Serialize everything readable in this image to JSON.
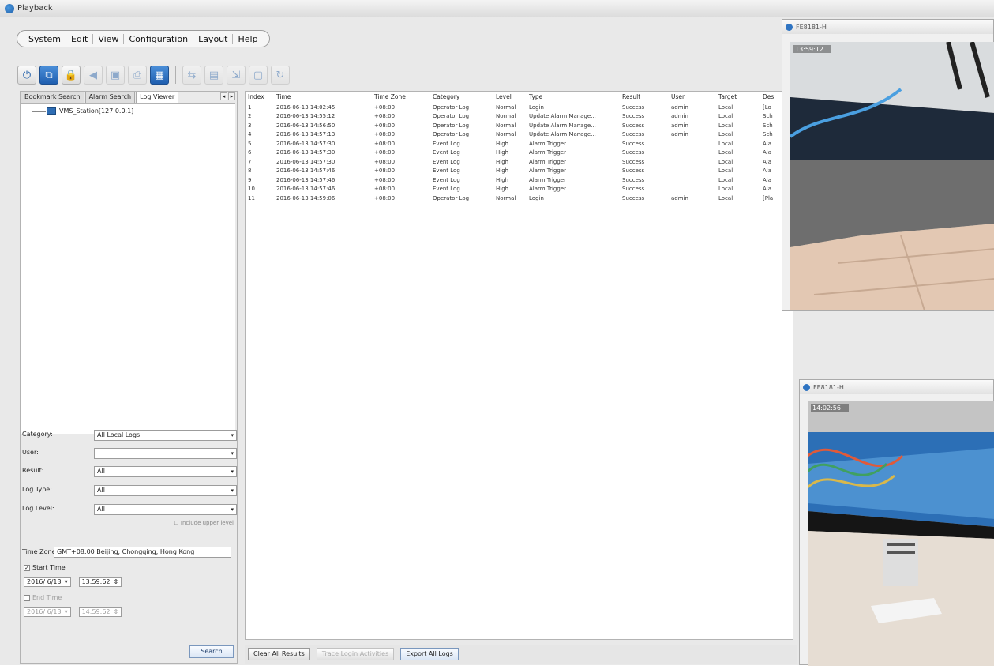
{
  "window": {
    "title": "Playback"
  },
  "menu": [
    "System",
    "Edit",
    "View",
    "Configuration",
    "Layout",
    "Help"
  ],
  "toolbar": {
    "buttons": [
      {
        "icon": "power-icon",
        "glyph": "⏻",
        "state": "normal"
      },
      {
        "icon": "network-icon",
        "glyph": "⧉",
        "state": "active"
      },
      {
        "icon": "lock-icon",
        "glyph": "🔒",
        "state": "normal"
      },
      {
        "icon": "audio-icon",
        "glyph": "◀",
        "state": "disabled"
      },
      {
        "icon": "camera-icon",
        "glyph": "▣",
        "state": "disabled"
      },
      {
        "icon": "print-icon",
        "glyph": "⎙",
        "state": "disabled"
      },
      {
        "icon": "layout-icon",
        "glyph": "▦",
        "state": "active"
      },
      {
        "icon": "sync-icon",
        "glyph": "⇆",
        "state": "disabled"
      },
      {
        "icon": "record-icon",
        "glyph": "▤",
        "state": "disabled"
      },
      {
        "icon": "export-icon",
        "glyph": "⇲",
        "state": "disabled"
      },
      {
        "icon": "snapshot-icon",
        "glyph": "▢",
        "state": "disabled"
      },
      {
        "icon": "refresh-icon",
        "glyph": "↻",
        "state": "disabled"
      }
    ]
  },
  "left": {
    "tabs": [
      "Bookmark Search",
      "Alarm Search",
      "Log Viewer"
    ],
    "active_tab": "Log Viewer",
    "tree_node": "VMS_Station[127.0.0.1]",
    "filters": {
      "category_label": "Category:",
      "category_value": "All Local Logs",
      "user_label": "User:",
      "user_value": "",
      "result_label": "Result:",
      "result_value": "All",
      "logtype_label": "Log Type:",
      "logtype_value": "All",
      "loglevel_label": "Log Level:",
      "loglevel_value": "All",
      "include_upper": "Include upper level"
    },
    "time": {
      "tz_label": "Time Zone:",
      "tz_value": "GMT+08:00 Beijing, Chongqing, Hong Kong",
      "start_label": "Start Time",
      "start_date": "2016/ 6/13",
      "start_time": "13:59:62",
      "end_label": "End Time",
      "end_date": "2016/ 6/13",
      "end_time": "14:59:62"
    },
    "search_label": "Search"
  },
  "table": {
    "columns": [
      "Index",
      "Time",
      "Time Zone",
      "Category",
      "Level",
      "Type",
      "Result",
      "User",
      "Target",
      "Des"
    ],
    "rows": [
      [
        "1",
        "2016-06-13 14:02:45",
        "+08:00",
        "Operator Log",
        "Normal",
        "Login",
        "Success",
        "admin",
        "Local",
        "[Lo"
      ],
      [
        "2",
        "2016-06-13 14:55:12",
        "+08:00",
        "Operator Log",
        "Normal",
        "Update Alarm Manage...",
        "Success",
        "admin",
        "Local",
        "Sch"
      ],
      [
        "3",
        "2016-06-13 14:56:50",
        "+08:00",
        "Operator Log",
        "Normal",
        "Update Alarm Manage...",
        "Success",
        "admin",
        "Local",
        "Sch"
      ],
      [
        "4",
        "2016-06-13 14:57:13",
        "+08:00",
        "Operator Log",
        "Normal",
        "Update Alarm Manage...",
        "Success",
        "admin",
        "Local",
        "Sch"
      ],
      [
        "5",
        "2016-06-13 14:57:30",
        "+08:00",
        "Event Log",
        "High",
        "Alarm Trigger",
        "Success",
        "",
        "Local",
        "Ala"
      ],
      [
        "6",
        "2016-06-13 14:57:30",
        "+08:00",
        "Event Log",
        "High",
        "Alarm Trigger",
        "Success",
        "",
        "Local",
        "Ala"
      ],
      [
        "7",
        "2016-06-13 14:57:30",
        "+08:00",
        "Event Log",
        "High",
        "Alarm Trigger",
        "Success",
        "",
        "Local",
        "Ala"
      ],
      [
        "8",
        "2016-06-13 14:57:46",
        "+08:00",
        "Event Log",
        "High",
        "Alarm Trigger",
        "Success",
        "",
        "Local",
        "Ala"
      ],
      [
        "9",
        "2016-06-13 14:57:46",
        "+08:00",
        "Event Log",
        "High",
        "Alarm Trigger",
        "Success",
        "",
        "Local",
        "Ala"
      ],
      [
        "10",
        "2016-06-13 14:57:46",
        "+08:00",
        "Event Log",
        "High",
        "Alarm Trigger",
        "Success",
        "",
        "Local",
        "Ala"
      ],
      [
        "11",
        "2016-06-13 14:59:06",
        "+08:00",
        "Operator Log",
        "Normal",
        "Login",
        "Success",
        "admin",
        "Local",
        "[Pla"
      ]
    ]
  },
  "bottom": {
    "clear": "Clear All Results",
    "trace": "Trace Login Activities",
    "export": "Export All Logs"
  },
  "video1": {
    "title": "FE8181-H",
    "timestamp": "13:59:12"
  },
  "video2": {
    "title": "FE8181-H",
    "timestamp": "14:02:56"
  }
}
